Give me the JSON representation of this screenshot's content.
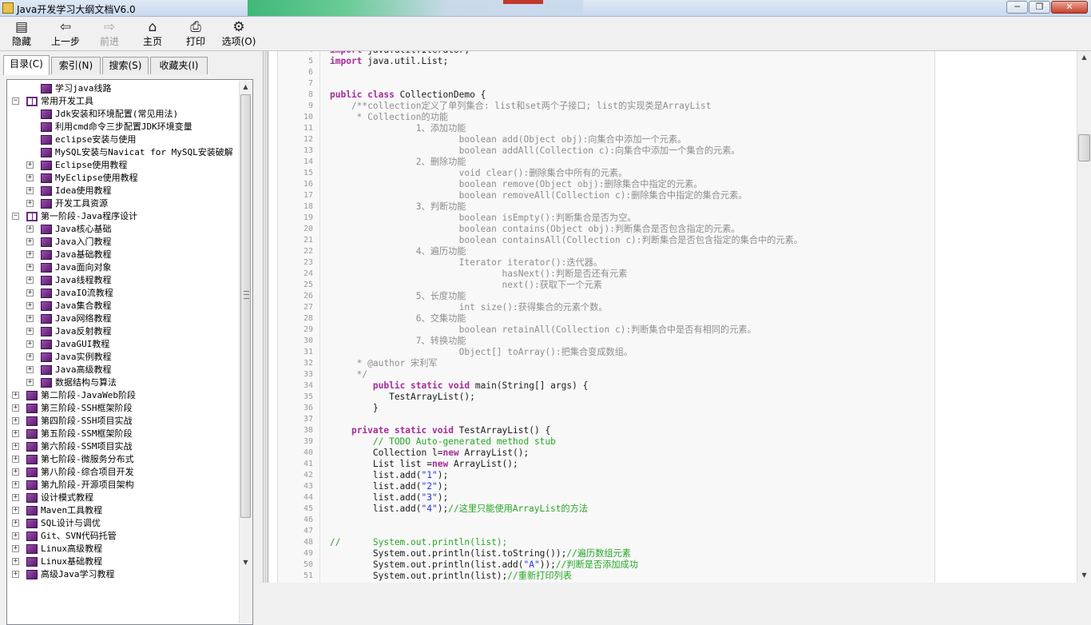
{
  "window": {
    "title": "Java开发学习大纲文档V6.0",
    "controls": [
      "─",
      "❐",
      "✕"
    ]
  },
  "toolbar": [
    {
      "name": "hide",
      "label": "隐藏",
      "icon": "panel-icon",
      "glyph": "▤",
      "enabled": true
    },
    {
      "name": "back",
      "label": "上一步",
      "icon": "back-arrow-icon",
      "glyph": "⇦",
      "enabled": true
    },
    {
      "name": "forward",
      "label": "前进",
      "icon": "forward-arrow-icon",
      "glyph": "⇨",
      "enabled": false
    },
    {
      "name": "home",
      "label": "主页",
      "icon": "home-icon",
      "glyph": "⌂",
      "enabled": true
    },
    {
      "name": "print",
      "label": "打印",
      "icon": "printer-icon",
      "glyph": "⎙",
      "enabled": true
    },
    {
      "name": "options",
      "label": "选项(O)",
      "icon": "options-icon",
      "glyph": "⚙",
      "enabled": true
    }
  ],
  "tabs": [
    "目录(C)",
    "索引(N)",
    "搜索(S)",
    "收藏夹(I)"
  ],
  "tree": [
    {
      "label": "学习java线路",
      "level": 1,
      "expander": "",
      "book": "closed"
    },
    {
      "label": "常用开发工具",
      "level": 0,
      "expander": "−",
      "book": "open"
    },
    {
      "label": "Jdk安装和环境配置(常见用法)",
      "level": 1,
      "expander": "",
      "book": "closed"
    },
    {
      "label": "利用cmd命令三步配置JDK环境变量",
      "level": 1,
      "expander": "",
      "book": "closed"
    },
    {
      "label": "eclipse安装与使用",
      "level": 1,
      "expander": "",
      "book": "closed"
    },
    {
      "label": "MySQL安装与Navicat for MySQL安装破解",
      "level": 1,
      "expander": "",
      "book": "closed"
    },
    {
      "label": "Eclipse使用教程",
      "level": 1,
      "expander": "+",
      "book": "closed"
    },
    {
      "label": "MyEclipse使用教程",
      "level": 1,
      "expander": "+",
      "book": "closed"
    },
    {
      "label": "Idea使用教程",
      "level": 1,
      "expander": "+",
      "book": "closed"
    },
    {
      "label": "开发工具资源",
      "level": 1,
      "expander": "+",
      "book": "closed"
    },
    {
      "label": "第一阶段-Java程序设计",
      "level": 0,
      "expander": "−",
      "book": "open"
    },
    {
      "label": "Java核心基础",
      "level": 1,
      "expander": "+",
      "book": "closed"
    },
    {
      "label": "Java入门教程",
      "level": 1,
      "expander": "+",
      "book": "closed"
    },
    {
      "label": "Java基础教程",
      "level": 1,
      "expander": "+",
      "book": "closed"
    },
    {
      "label": "Java面向对象",
      "level": 1,
      "expander": "+",
      "book": "closed"
    },
    {
      "label": "Java线程教程",
      "level": 1,
      "expander": "+",
      "book": "closed"
    },
    {
      "label": "JavaIO流教程",
      "level": 1,
      "expander": "+",
      "book": "closed"
    },
    {
      "label": "Java集合教程",
      "level": 1,
      "expander": "+",
      "book": "closed"
    },
    {
      "label": "Java网络教程",
      "level": 1,
      "expander": "+",
      "book": "closed"
    },
    {
      "label": "Java反射教程",
      "level": 1,
      "expander": "+",
      "book": "closed"
    },
    {
      "label": "JavaGUI教程",
      "level": 1,
      "expander": "+",
      "book": "closed"
    },
    {
      "label": "Java实例教程",
      "level": 1,
      "expander": "+",
      "book": "closed"
    },
    {
      "label": "Java高级教程",
      "level": 1,
      "expander": "+",
      "book": "closed"
    },
    {
      "label": "数据结构与算法",
      "level": 1,
      "expander": "+",
      "book": "closed"
    },
    {
      "label": "第二阶段-JavaWeb阶段",
      "level": 0,
      "expander": "+",
      "book": "closed"
    },
    {
      "label": "第三阶段-SSH框架阶段",
      "level": 0,
      "expander": "+",
      "book": "closed"
    },
    {
      "label": "第四阶段-SSH项目实战",
      "level": 0,
      "expander": "+",
      "book": "closed"
    },
    {
      "label": "第五阶段-SSM框架阶段",
      "level": 0,
      "expander": "+",
      "book": "closed"
    },
    {
      "label": "第六阶段-SSM项目实战",
      "level": 0,
      "expander": "+",
      "book": "closed"
    },
    {
      "label": "第七阶段-微服务分布式",
      "level": 0,
      "expander": "+",
      "book": "closed"
    },
    {
      "label": "第八阶段-综合项目开发",
      "level": 0,
      "expander": "+",
      "book": "closed"
    },
    {
      "label": "第九阶段-开源项目架构",
      "level": 0,
      "expander": "+",
      "book": "closed"
    },
    {
      "label": "设计模式教程",
      "level": 0,
      "expander": "+",
      "book": "closed"
    },
    {
      "label": "Maven工具教程",
      "level": 0,
      "expander": "+",
      "book": "closed"
    },
    {
      "label": "SQL设计与调优",
      "level": 0,
      "expander": "+",
      "book": "closed"
    },
    {
      "label": "Git、SVN代码托管",
      "level": 0,
      "expander": "+",
      "book": "closed"
    },
    {
      "label": "Linux高级教程",
      "level": 0,
      "expander": "+",
      "book": "closed"
    },
    {
      "label": "Linux基础教程",
      "level": 0,
      "expander": "+",
      "book": "closed"
    },
    {
      "label": "高级Java学习教程",
      "level": 0,
      "expander": "+",
      "book": "closed"
    }
  ],
  "code": [
    {
      "n": "4",
      "tokens": [
        [
          "kw",
          "import"
        ],
        [
          "pl",
          " java.util.Iterator;"
        ]
      ]
    },
    {
      "n": "5",
      "tokens": [
        [
          "kw",
          "import"
        ],
        [
          "pl",
          " java.util.List;"
        ]
      ]
    },
    {
      "n": "6",
      "tokens": []
    },
    {
      "n": "7",
      "tokens": []
    },
    {
      "n": "8",
      "tokens": [
        [
          "kw",
          "public class"
        ],
        [
          "pl",
          " CollectionDemo {"
        ]
      ]
    },
    {
      "n": "9",
      "tokens": [
        [
          "cm",
          "    /**collection定义了单列集合: list和set两个子接口; list的实现类是ArrayList"
        ]
      ]
    },
    {
      "n": "10",
      "tokens": [
        [
          "cm",
          "     * Collection的功能"
        ]
      ]
    },
    {
      "n": "11",
      "tokens": [
        [
          "cm",
          "                1、添加功能"
        ]
      ]
    },
    {
      "n": "12",
      "tokens": [
        [
          "cm",
          "                        boolean add(Object obj):向集合中添加一个元素。"
        ]
      ]
    },
    {
      "n": "13",
      "tokens": [
        [
          "cm",
          "                        boolean addAll(Collection c):向集合中添加一个集合的元素。"
        ]
      ]
    },
    {
      "n": "14",
      "tokens": [
        [
          "cm",
          "                2、删除功能"
        ]
      ]
    },
    {
      "n": "15",
      "tokens": [
        [
          "cm",
          "                        void clear():删除集合中所有的元素。"
        ]
      ]
    },
    {
      "n": "16",
      "tokens": [
        [
          "cm",
          "                        boolean remove(Object obj):删除集合中指定的元素。"
        ]
      ]
    },
    {
      "n": "17",
      "tokens": [
        [
          "cm",
          "                        boolean removeAll(Collection c):删除集合中指定的集合元素。"
        ]
      ]
    },
    {
      "n": "18",
      "tokens": [
        [
          "cm",
          "                3、判断功能"
        ]
      ]
    },
    {
      "n": "19",
      "tokens": [
        [
          "cm",
          "                        boolean isEmpty():判断集合是否为空。"
        ]
      ]
    },
    {
      "n": "20",
      "tokens": [
        [
          "cm",
          "                        boolean contains(Object obj):判断集合是否包含指定的元素。"
        ]
      ]
    },
    {
      "n": "21",
      "tokens": [
        [
          "cm",
          "                        boolean containsAll(Collection c):判断集合是否包含指定的集合中的元素。"
        ]
      ]
    },
    {
      "n": "22",
      "tokens": [
        [
          "cm",
          "                4、遍历功能"
        ]
      ]
    },
    {
      "n": "23",
      "tokens": [
        [
          "cm",
          "                        Iterator iterator():迭代器。"
        ]
      ]
    },
    {
      "n": "24",
      "tokens": [
        [
          "cm",
          "                                hasNext():判断是否还有元素"
        ]
      ]
    },
    {
      "n": "25",
      "tokens": [
        [
          "cm",
          "                                next():获取下一个元素"
        ]
      ]
    },
    {
      "n": "26",
      "tokens": [
        [
          "cm",
          "                5、长度功能"
        ]
      ]
    },
    {
      "n": "27",
      "tokens": [
        [
          "cm",
          "                        int size():获得集合的元素个数。"
        ]
      ]
    },
    {
      "n": "28",
      "tokens": [
        [
          "cm",
          "                6、交集功能"
        ]
      ]
    },
    {
      "n": "29",
      "tokens": [
        [
          "cm",
          "                        boolean retainAll(Collection c):判断集合中是否有相同的元素。"
        ]
      ]
    },
    {
      "n": "30",
      "tokens": [
        [
          "cm",
          "                7、转换功能"
        ]
      ]
    },
    {
      "n": "31",
      "tokens": [
        [
          "cm",
          "                        Object[] toArray():把集合变成数组。"
        ]
      ]
    },
    {
      "n": "32",
      "tokens": [
        [
          "cm",
          "     * @author 宋利军"
        ]
      ]
    },
    {
      "n": "33",
      "tokens": [
        [
          "cm",
          "     */"
        ]
      ]
    },
    {
      "n": "34",
      "tokens": [
        [
          "pl",
          "        "
        ],
        [
          "kw",
          "public static void"
        ],
        [
          "pl",
          " main(String[] args) {"
        ]
      ]
    },
    {
      "n": "35",
      "tokens": [
        [
          "pl",
          "           TestArrayList();"
        ]
      ]
    },
    {
      "n": "36",
      "tokens": [
        [
          "pl",
          "        }"
        ]
      ]
    },
    {
      "n": "37",
      "tokens": []
    },
    {
      "n": "38",
      "tokens": [
        [
          "pl",
          "    "
        ],
        [
          "kw",
          "private static void"
        ],
        [
          "pl",
          " TestArrayList() {"
        ]
      ]
    },
    {
      "n": "39",
      "tokens": [
        [
          "gr",
          "        // TODO Auto-generated method stub"
        ]
      ]
    },
    {
      "n": "40",
      "tokens": [
        [
          "pl",
          "        Collection l="
        ],
        [
          "kw",
          "new"
        ],
        [
          "pl",
          " ArrayList();"
        ]
      ]
    },
    {
      "n": "41",
      "tokens": [
        [
          "pl",
          "        List list ="
        ],
        [
          "kw",
          "new"
        ],
        [
          "pl",
          " ArrayList();"
        ]
      ]
    },
    {
      "n": "42",
      "tokens": [
        [
          "pl",
          "        list.add("
        ],
        [
          "st",
          "\"1\""
        ],
        [
          "pl",
          ");"
        ]
      ]
    },
    {
      "n": "43",
      "tokens": [
        [
          "pl",
          "        list.add("
        ],
        [
          "st",
          "\"2\""
        ],
        [
          "pl",
          ");"
        ]
      ]
    },
    {
      "n": "44",
      "tokens": [
        [
          "pl",
          "        list.add("
        ],
        [
          "st",
          "\"3\""
        ],
        [
          "pl",
          ");"
        ]
      ]
    },
    {
      "n": "45",
      "tokens": [
        [
          "pl",
          "        list.add("
        ],
        [
          "st",
          "\"4\""
        ],
        [
          "pl",
          ");"
        ],
        [
          "gr",
          "//这里只能使用ArrayList的方法"
        ]
      ]
    },
    {
      "n": "46",
      "tokens": []
    },
    {
      "n": "47",
      "tokens": []
    },
    {
      "n": "48",
      "tokens": [
        [
          "gr",
          "//      System.out.println(list);"
        ]
      ]
    },
    {
      "n": "49",
      "tokens": [
        [
          "pl",
          "        System.out.println(list.toString());"
        ],
        [
          "gr",
          "//遍历数组元素"
        ]
      ]
    },
    {
      "n": "50",
      "tokens": [
        [
          "pl",
          "        System.out.println(list.add("
        ],
        [
          "st",
          "\"A\""
        ],
        [
          "pl",
          "));"
        ],
        [
          "gr",
          "//判断是否添加成功"
        ]
      ]
    },
    {
      "n": "51",
      "tokens": [
        [
          "pl",
          "        System.out.println(list);"
        ],
        [
          "gr",
          "//重新打印列表"
        ]
      ]
    }
  ]
}
